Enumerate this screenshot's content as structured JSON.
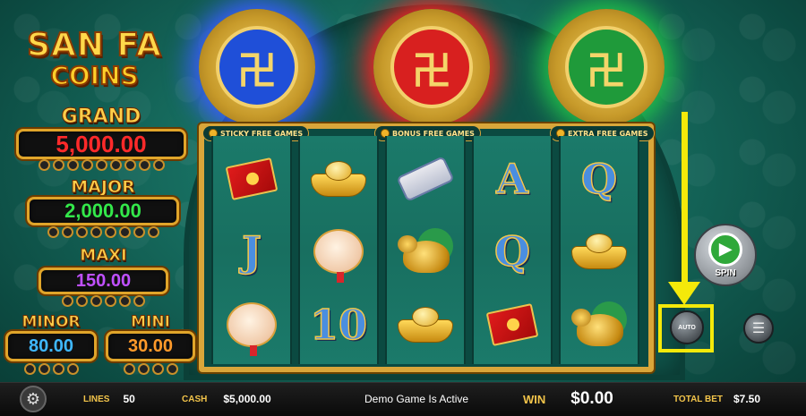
{
  "logo": {
    "line1": "SAN FA",
    "line2": "COINS"
  },
  "jackpots": [
    {
      "label": "GRAND",
      "value": "5,000.00",
      "color": "#ff2a2a"
    },
    {
      "label": "MAJOR",
      "value": "2,000.00",
      "color": "#33e84a"
    },
    {
      "label": "MAXI",
      "value": "150.00",
      "color": "#c050ff"
    },
    {
      "label": "MINOR",
      "value": "80.00",
      "color": "#3fb8ff"
    },
    {
      "label": "MINI",
      "value": "30.00",
      "color": "#ff9a2a"
    }
  ],
  "medallions": [
    {
      "name": "blue",
      "color": "#1f4fd8",
      "glow": "#3a5cff"
    },
    {
      "name": "red",
      "color": "#d8201f",
      "glow": "#ff2020"
    },
    {
      "name": "green",
      "color": "#1f9a3a",
      "glow": "#22c24a"
    }
  ],
  "features": {
    "sticky": "STICKY FREE GAMES",
    "bonus": "BONUS FREE GAMES",
    "extra": "EXTRA FREE GAMES"
  },
  "reels": [
    [
      "red-envelope",
      "J",
      "lantern"
    ],
    [
      "gold-ingot",
      "lantern",
      "10"
    ],
    [
      "scroll",
      "golden-turtle",
      "gold-ingot"
    ],
    [
      "A",
      "Q",
      "red-envelope"
    ],
    [
      "Q",
      "gold-ingot",
      "golden-turtle"
    ]
  ],
  "controls": {
    "spin_label": "SPIN",
    "auto_label": "AUTO"
  },
  "bottom_bar": {
    "lines_label": "LINES",
    "lines_value": "50",
    "cash_label": "CASH",
    "cash_value": "$5,000.00",
    "status": "Demo Game Is Active",
    "win_label": "WIN",
    "win_value": "$0.00",
    "total_bet_label": "TOTAL BET",
    "total_bet_value": "$7.50"
  },
  "icons": {
    "settings": "gear-icon",
    "coins": "coin-stack-icon",
    "spin": "play-arrow-icon"
  }
}
